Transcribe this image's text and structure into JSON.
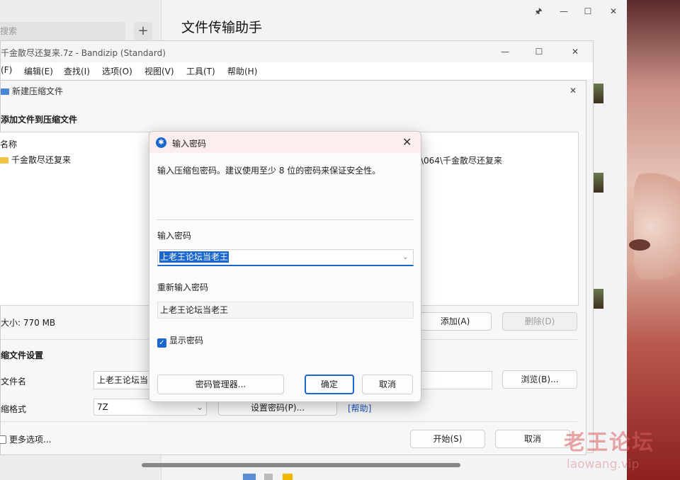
{
  "chat": {
    "search_placeholder": "搜索",
    "add_label": "+",
    "title": "文件传输助手",
    "window_controls": [
      "🖈",
      "—",
      "☐",
      "✕"
    ]
  },
  "bandizip": {
    "title": "千金散尽还复来.7z - Bandizip (Standard)",
    "window_controls": [
      "—",
      "☐",
      "✕"
    ],
    "menu": [
      "(F)",
      "编辑(E)",
      "查找(I)",
      "选项(O)",
      "视图(V)",
      "工具(T)",
      "帮助(H)"
    ]
  },
  "new_archive": {
    "title": "新建压缩文件",
    "close": "✕",
    "section_add": "添加文件到压缩文件",
    "list_header": "名称",
    "list_item": "千金散尽还复来",
    "list_path": "\\064\\千金散尽还复来",
    "size_label": "大小: 770 MB",
    "add_button": "添加(A)",
    "delete_button": "删除(D)",
    "section_settings": "缩文件设置",
    "filename_label": "文件名",
    "filename_value": "上老王论坛当",
    "browse_button": "浏览(B)...",
    "format_label": "缩格式",
    "format_value": "7Z",
    "set_password_button": "设置密码(P)...",
    "help_link": "[帮助]",
    "more_options": "更多选项...",
    "start_button": "开始(S)",
    "cancel_button": "取消"
  },
  "password_dialog": {
    "title": "输入密码",
    "close": "✕",
    "description": "输入压缩包密码。建议使用至少 8 位的密码来保证安全性。",
    "label_password": "输入密码",
    "password_value": "上老王论坛当老王",
    "label_confirm": "重新输入密码",
    "confirm_value": "上老王论坛当老王",
    "show_password_label": "显示密码",
    "show_password_checked": true,
    "manager_button": "密码管理器...",
    "ok_button": "确定",
    "cancel_button": "取消"
  },
  "watermark": {
    "text": "老王论坛",
    "url": "laowang.vip"
  }
}
